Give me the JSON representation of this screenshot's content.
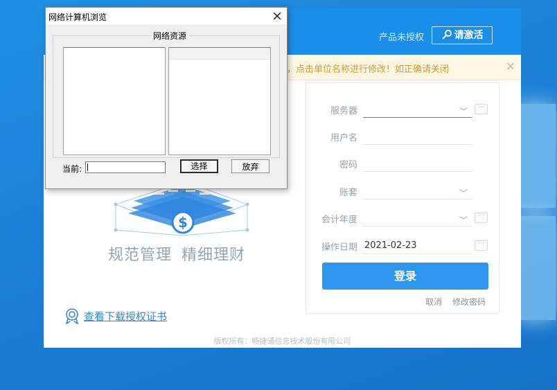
{
  "app": {
    "license_status": "产品未授权",
    "activate_label": "请激活",
    "notice": "称，点击单位名称进行修改！如正确请关闭",
    "notice_close": "×",
    "slogan_part1": "规范管理",
    "slogan_part2": "精细理财",
    "cert_link": "查看下载授权证书",
    "footer": "版权所有：畅捷通信息技术股份有限公司"
  },
  "login": {
    "server_label": "服务器",
    "server_value": "",
    "user_label": "用户名",
    "user_value": "",
    "password_label": "密码",
    "password_value": "",
    "account_set_label": "账套",
    "account_set_value": "",
    "fiscal_year_label": "会计年度",
    "fiscal_year_value": "",
    "date_label": "操作日期",
    "date_value": "2021-02-23",
    "more_glyph": "···",
    "login_button": "登录",
    "cancel_link": "取消",
    "change_password_link": "修改密码"
  },
  "dialog": {
    "title": "网络计算机浏览",
    "close": "×",
    "group_caption": "网络资源",
    "current_label": "当前:",
    "current_value": "",
    "select_button": "选择",
    "abandon_button": "放弃"
  },
  "colors": {
    "brand_blue": "#1a8ee8",
    "login_button": "#2e96ec",
    "notice_text": "#d29a3a",
    "desktop_blue": "#1c7fd6"
  }
}
